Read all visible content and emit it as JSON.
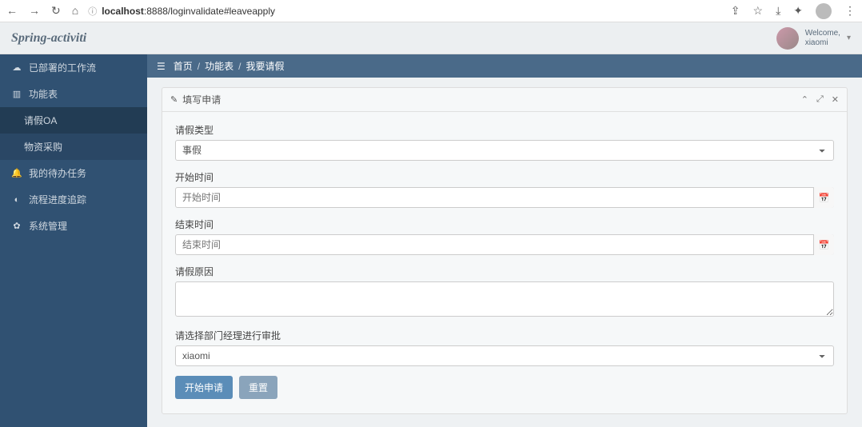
{
  "browser": {
    "url_host": "localhost",
    "url_path": ":8888/loginvalidate#leaveapply"
  },
  "header": {
    "brand": "Spring-activiti",
    "welcome": "Welcome,",
    "username": "xiaomi"
  },
  "sidebar": {
    "items": [
      {
        "icon": "cloud",
        "label": "已部署的工作流",
        "expandable": false
      },
      {
        "icon": "chart",
        "label": "功能表",
        "expandable": true,
        "expanded": true
      },
      {
        "icon": "bell",
        "label": "我的待办任务",
        "expandable": false
      },
      {
        "icon": "dashboard",
        "label": "流程进度追踪",
        "expandable": false
      },
      {
        "icon": "gear",
        "label": "系统管理",
        "expandable": false
      }
    ],
    "children": [
      {
        "label": "请假OA",
        "active": true
      },
      {
        "label": "物资采购",
        "active": false
      }
    ]
  },
  "breadcrumb": {
    "home": "首页",
    "section": "功能表",
    "page": "我要请假"
  },
  "panel": {
    "title": "填写申请"
  },
  "form": {
    "leave_type_label": "请假类型",
    "leave_type_value": "事假",
    "start_time_label": "开始时间",
    "start_time_placeholder": "开始时间",
    "end_time_label": "结束时间",
    "end_time_placeholder": "结束时间",
    "reason_label": "请假原因",
    "approver_label": "请选择部门经理进行审批",
    "approver_value": "xiaomi",
    "submit_label": "开始申请",
    "reset_label": "重置"
  }
}
